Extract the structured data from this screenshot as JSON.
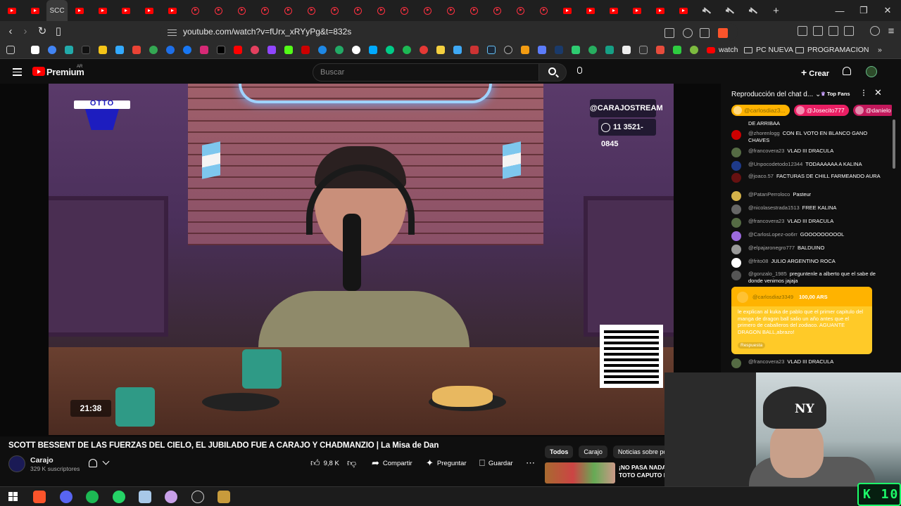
{
  "browser": {
    "active_tab_label": "SCC",
    "url": "youtube.com/watch?v=fUrx_xRYyPg&t=832s",
    "bookmarks": {
      "watch_label": "watch",
      "folder1": "PC NUEVA",
      "folder2": "PROGRAMACION"
    },
    "window_controls": {
      "minimize": "—",
      "restore": "❐",
      "close": "✕"
    }
  },
  "youtube": {
    "logo_text": "Premium",
    "region": "AR",
    "search_placeholder": "Buscar",
    "create_label": "Crear"
  },
  "video": {
    "overlay_handle": "@CARAJOSTREAM",
    "overlay_phone": "11 3521-0845",
    "timer": "21:38",
    "logo_text": "OTTO",
    "title": "SCOTT BESSENT DE LAS FUERZAS DEL CIELO, EL JUBILADO FUE A CARAJO Y CHADMANZIO | La Misa de Dan",
    "channel": "Carajo",
    "subscribers": "329 K suscriptores",
    "likes": "9,8 K",
    "share_label": "Compartir",
    "ask_label": "Preguntar",
    "save_label": "Guardar"
  },
  "chips": [
    "Todos",
    "Carajo",
    "Noticias sobre politic"
  ],
  "recommendation": {
    "line1": "¡NO PASA NADA",
    "line2": "TOTO CAPUTO NO"
  },
  "chat": {
    "header": "Reproducción del chat d...",
    "top_fans": "Top Fans",
    "pills": [
      "@carlosdiaz3...",
      "@Josecito777",
      "@danielo"
    ],
    "messages": [
      {
        "user": "",
        "text": "DE ARRIBAA"
      },
      {
        "user": "@zhorenlogg",
        "text": "CON EL VOTO EN BLANCO GANO CHAVES"
      },
      {
        "user": "@francovera23",
        "text": "VLAD III DRACULA"
      },
      {
        "user": "@Unpocodetodo12344",
        "text": "TODAAAAAA A KALINA"
      },
      {
        "user": "@joaco.57",
        "text": "FACTURAS DE CHILL FARMEANDO AURA"
      },
      {
        "user": "@PatanPerroloco",
        "text": "Pasteur"
      },
      {
        "user": "@nicolasestrada1513",
        "text": "FREE KALINA"
      },
      {
        "user": "@francovera23",
        "text": "VLAD III DRACULA"
      },
      {
        "user": "@CarlosLopez-oo6rr",
        "text": "GOOOOOOOOOL"
      },
      {
        "user": "@elpajaronegro777",
        "text": "BALDUINO"
      },
      {
        "user": "@frito08",
        "text": "JULIO ARGENTINO ROCA"
      },
      {
        "user": "@gonzalo_1985",
        "text": "preguntenle a alberto que el sabe de donde venimos jajaja"
      },
      {
        "user": "@francovera23",
        "text": "VLAD III DRACULA"
      }
    ],
    "superchat": {
      "user": "@carlosdiaz3349",
      "amount": "100,00 ARS",
      "text": "le explican al kuka de pablo que el primer capitulo del manga de dragon ball salio un año antes que el primero de caballeros del zodiaco. AGUANTE DRAGON BALL,abrazo!",
      "reply_label": "Respuesta"
    }
  },
  "stream_overlay": {
    "cap_logo": "NY",
    "badge": "K 10"
  },
  "colors": {
    "youtube_red": "#ff0000",
    "superchat_yellow": "#ffca28",
    "badge_green": "#1dff6a"
  }
}
